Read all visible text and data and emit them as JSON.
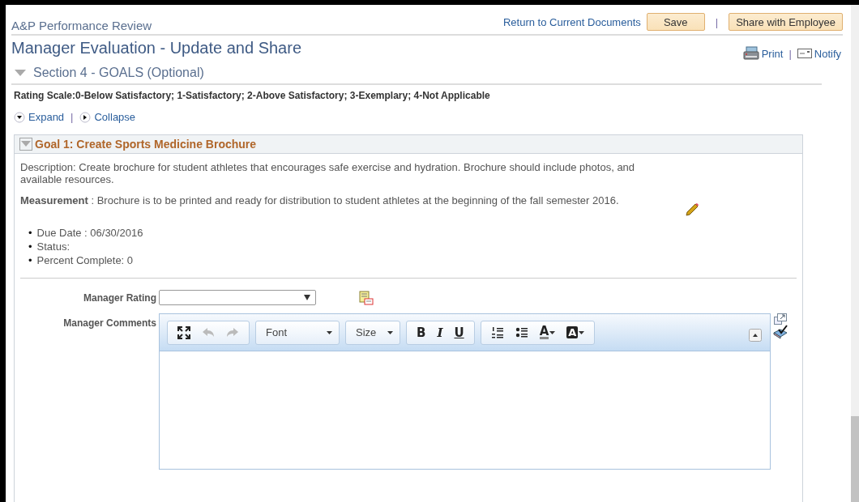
{
  "header": {
    "app_title": "A&P Performance Review",
    "links": [
      "Return to Current Documents"
    ],
    "save_button": "Save",
    "separator": "|",
    "share_button": "Share with Employee"
  },
  "page_title": "Manager Evaluation - Update and Share",
  "actions": {
    "print": "Print",
    "separator": "|",
    "notify": "Notify"
  },
  "section": {
    "title": "Section 4 - GOALS (Optional)",
    "expanded": true
  },
  "rating_scale": "Rating Scale:0-Below Satisfactory; 1-Satisfactory; 2-Above Satisfactory; 3-Exemplary; 4-Not Applicable",
  "expand_collapse": {
    "expand": "Expand",
    "separator": "|",
    "collapse": "Collapse"
  },
  "goal": {
    "title": "Goal 1: Create Sports Medicine Brochure",
    "expanded": true,
    "description": "Description: Create brochure for student athletes that encourages safe exercise and hydration. Brochure should include photos, and available resources.",
    "measurement": "**Measurement** : Brochure is to be printed and ready for distribution to student athletes at the beginning of the fall semester 2016.",
    "details": [
      {
        "bullet": "•",
        "text": "Due Date : 06/30/2016"
      },
      {
        "bullet": "•",
        "text": "Status:"
      },
      {
        "bullet": "•",
        "text": "Percent Complete: 0"
      }
    ]
  },
  "manager_rating": {
    "label": "Manager Rating"
  },
  "manager_comments": {
    "label": "Manager Comments",
    "toolbar": [
      [
        {
          "kind": "maximize",
          "disabled": false
        },
        {
          "kind": "undo",
          "disabled": true
        },
        {
          "kind": "redo",
          "disabled": true
        }
      ],
      [
        {
          "kind": "dropdown",
          "label": "Font"
        }
      ],
      [
        {
          "kind": "dropdown",
          "label": "Size"
        }
      ],
      [
        {
          "kind": "bold",
          "label": "B"
        },
        {
          "kind": "italic",
          "label": "I"
        },
        {
          "kind": "underline",
          "label": "U"
        }
      ],
      [
        {
          "kind": "numbered-list"
        },
        {
          "kind": "bulleted-list"
        },
        {
          "kind": "text-color",
          "label": "A"
        },
        {
          "kind": "bg-color",
          "label": "A"
        }
      ]
    ]
  }
}
